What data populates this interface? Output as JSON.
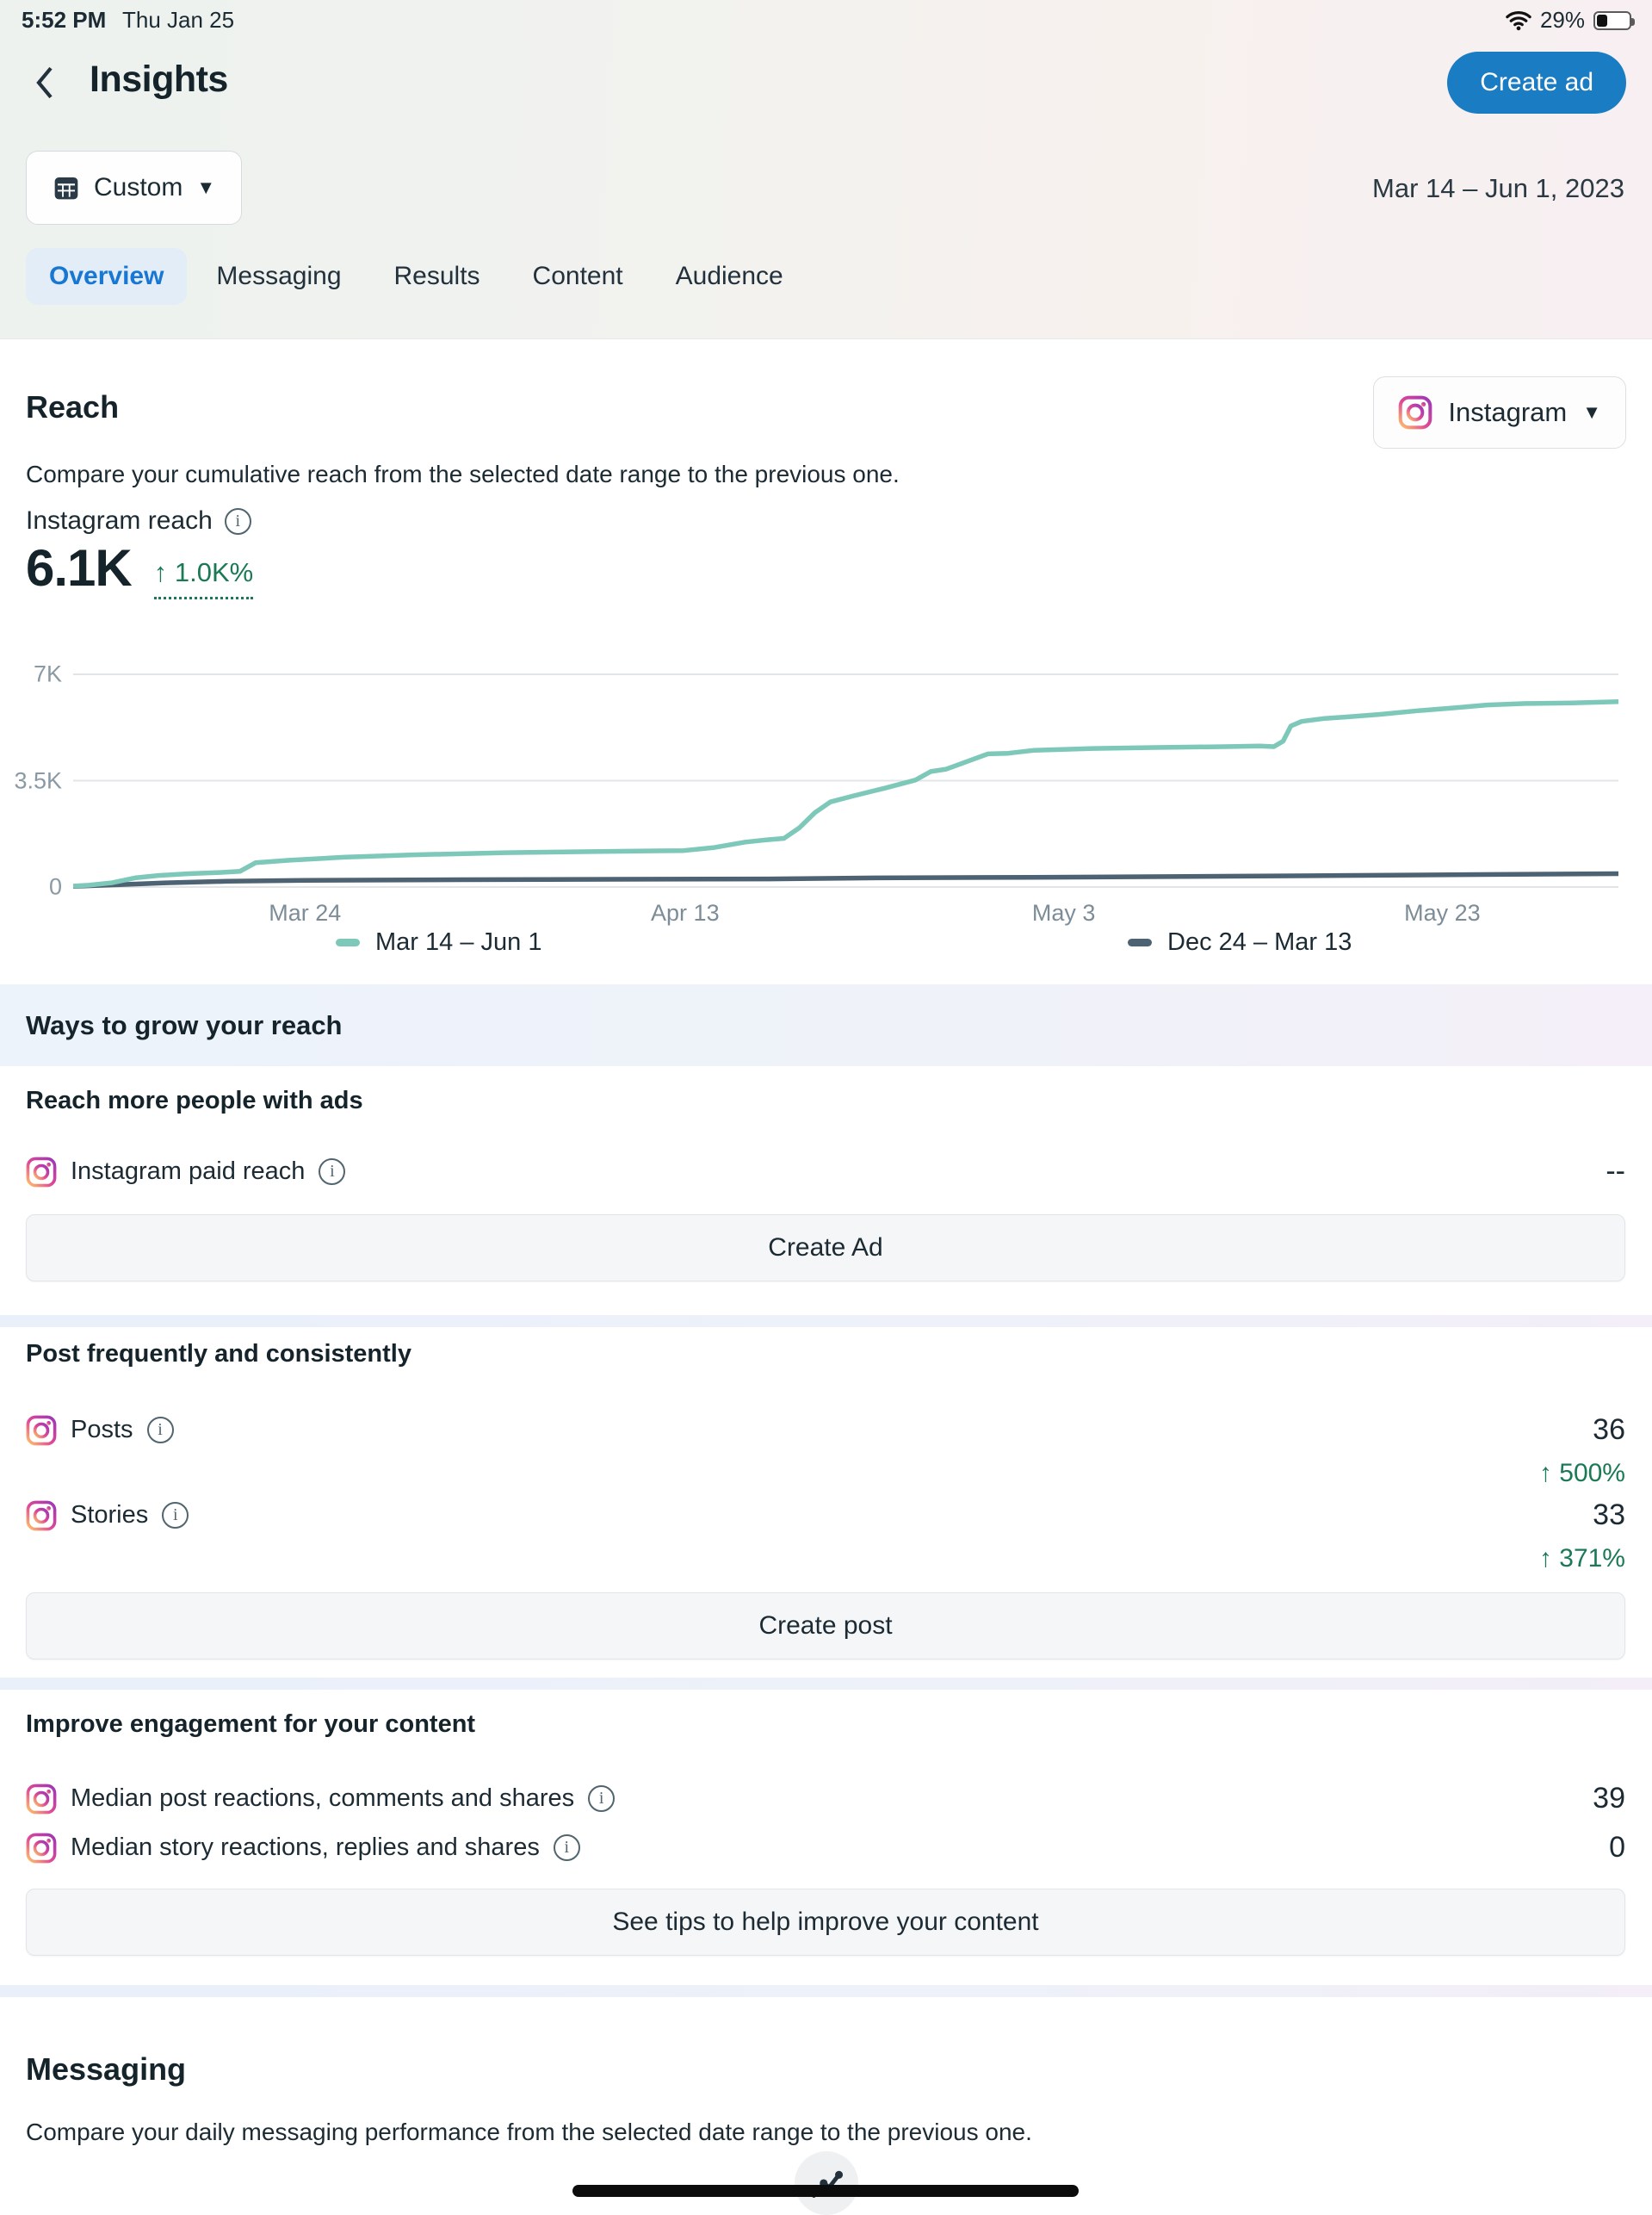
{
  "status_bar": {
    "time": "5:52 PM",
    "date": "Thu Jan 25",
    "battery_percent": "29%"
  },
  "header": {
    "title": "Insights",
    "create_ad_button": "Create ad",
    "date_filter_button": "Custom",
    "date_range": "Mar 14 – Jun 1, 2023"
  },
  "tabs": [
    {
      "label": "Overview",
      "active": true
    },
    {
      "label": "Messaging",
      "active": false
    },
    {
      "label": "Results",
      "active": false
    },
    {
      "label": "Content",
      "active": false
    },
    {
      "label": "Audience",
      "active": false
    }
  ],
  "reach": {
    "title": "Reach",
    "platform_selector": "Instagram",
    "description": "Compare your cumulative reach from the selected date range to the previous one.",
    "metric_label": "Instagram reach",
    "metric_value": "6.1K",
    "metric_change": "↑ 1.0K%"
  },
  "chart_data": {
    "type": "line",
    "title": "Instagram reach",
    "ylim": [
      0,
      7000
    ],
    "grid": true,
    "legend_position": "bottom",
    "yticks": [
      {
        "label": "7K",
        "value": 7000
      },
      {
        "label": "3.5K",
        "value": 3500
      },
      {
        "label": "0",
        "value": 0
      }
    ],
    "xticks": [
      {
        "label": "Mar 24",
        "frac": 0.15
      },
      {
        "label": "Apr 13",
        "frac": 0.396
      },
      {
        "label": "May 3",
        "frac": 0.641
      },
      {
        "label": "May 23",
        "frac": 0.886
      }
    ],
    "series": [
      {
        "name": "Mar 14 – Jun 1",
        "color": "#7ec8ba",
        "points": [
          [
            0.0,
            30
          ],
          [
            0.01,
            60
          ],
          [
            0.025,
            140
          ],
          [
            0.04,
            300
          ],
          [
            0.055,
            380
          ],
          [
            0.075,
            440
          ],
          [
            0.095,
            480
          ],
          [
            0.108,
            520
          ],
          [
            0.118,
            800
          ],
          [
            0.14,
            880
          ],
          [
            0.175,
            980
          ],
          [
            0.22,
            1060
          ],
          [
            0.28,
            1130
          ],
          [
            0.34,
            1170
          ],
          [
            0.395,
            1200
          ],
          [
            0.415,
            1300
          ],
          [
            0.435,
            1480
          ],
          [
            0.45,
            1560
          ],
          [
            0.46,
            1600
          ],
          [
            0.47,
            1950
          ],
          [
            0.48,
            2450
          ],
          [
            0.49,
            2800
          ],
          [
            0.505,
            3000
          ],
          [
            0.525,
            3250
          ],
          [
            0.545,
            3520
          ],
          [
            0.555,
            3800
          ],
          [
            0.565,
            3880
          ],
          [
            0.578,
            4120
          ],
          [
            0.592,
            4380
          ],
          [
            0.605,
            4400
          ],
          [
            0.622,
            4500
          ],
          [
            0.66,
            4560
          ],
          [
            0.7,
            4590
          ],
          [
            0.745,
            4620
          ],
          [
            0.768,
            4640
          ],
          [
            0.777,
            4620
          ],
          [
            0.783,
            4800
          ],
          [
            0.788,
            5300
          ],
          [
            0.795,
            5450
          ],
          [
            0.81,
            5550
          ],
          [
            0.825,
            5600
          ],
          [
            0.845,
            5680
          ],
          [
            0.87,
            5800
          ],
          [
            0.895,
            5900
          ],
          [
            0.915,
            5990
          ],
          [
            0.94,
            6040
          ],
          [
            0.97,
            6060
          ],
          [
            1.0,
            6100
          ]
        ]
      },
      {
        "name": "Dec 24 – Mar 13",
        "color": "#4d6373",
        "points": [
          [
            0.0,
            20
          ],
          [
            0.03,
            80
          ],
          [
            0.06,
            140
          ],
          [
            0.1,
            190
          ],
          [
            0.15,
            220
          ],
          [
            0.25,
            240
          ],
          [
            0.35,
            255
          ],
          [
            0.45,
            265
          ],
          [
            0.52,
            300
          ],
          [
            0.62,
            320
          ],
          [
            0.72,
            345
          ],
          [
            0.82,
            380
          ],
          [
            0.91,
            410
          ],
          [
            1.0,
            440
          ]
        ]
      }
    ]
  },
  "grow": {
    "band_title": "Ways to grow your reach",
    "ads": {
      "title": "Reach more people with ads",
      "metric_label": "Instagram paid reach",
      "metric_value": "--",
      "button": "Create Ad"
    },
    "posting": {
      "title": "Post frequently and consistently",
      "metrics": [
        {
          "label": "Posts",
          "value": "36",
          "change": "↑ 500%"
        },
        {
          "label": "Stories",
          "value": "33",
          "change": "↑ 371%"
        }
      ],
      "button": "Create post"
    },
    "engagement": {
      "title": "Improve engagement for your content",
      "metrics": [
        {
          "label": "Median post reactions, comments and shares",
          "value": "39"
        },
        {
          "label": "Median story reactions, replies and shares",
          "value": "0"
        }
      ],
      "button": "See tips to help improve your content"
    }
  },
  "messaging": {
    "title": "Messaging",
    "description": "Compare your daily messaging performance from the selected date range to the previous one."
  },
  "colors": {
    "accent_blue": "#1a7cc2",
    "tab_active_blue": "#1877d2",
    "positive_green": "#1b7a55",
    "series_current": "#7ec8ba",
    "series_previous": "#4d6373"
  }
}
